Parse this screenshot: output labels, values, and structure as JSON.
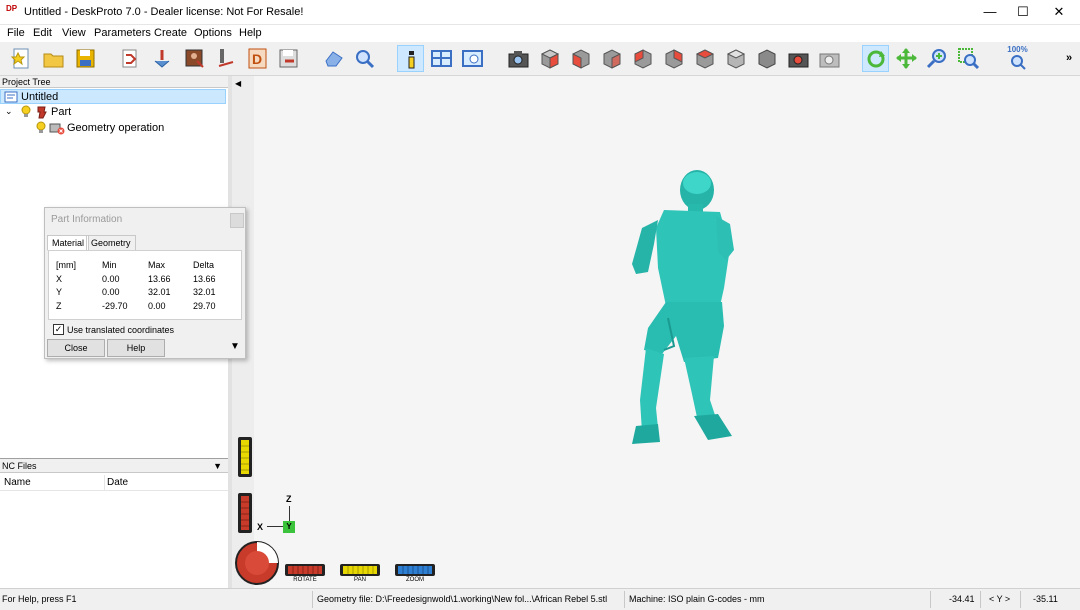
{
  "window": {
    "title": "Untitled - DeskProto 7.0 - Dealer license: Not For Resale!",
    "app_icon": "DP",
    "minimize": "—",
    "maximize": "☐",
    "close": "✕"
  },
  "menu": [
    "File",
    "Edit",
    "View",
    "Parameters",
    "Create",
    "Options",
    "Help"
  ],
  "toolbar": {
    "more": "»",
    "zoom_100": "100%"
  },
  "project_tree": {
    "header": "Project Tree",
    "root": "Untitled",
    "part": "Part",
    "geometry_operation": "Geometry operation"
  },
  "nc_files": {
    "header": "NC Files",
    "col_name": "Name",
    "col_date": "Date"
  },
  "part_info": {
    "title": "Part Information",
    "tabs": [
      "Material",
      "Geometry"
    ],
    "headers": [
      "[mm]",
      "Min",
      "Max",
      "Delta"
    ],
    "rows": [
      [
        "X",
        "0.00",
        "13.66",
        "13.66"
      ],
      [
        "Y",
        "0.00",
        "32.01",
        "32.01"
      ],
      [
        "Z",
        "-29.70",
        "0.00",
        "29.70"
      ]
    ],
    "checkbox_label": "Use translated coordinates",
    "checkbox_checked": true,
    "close_label": "Close",
    "help_label": "Help"
  },
  "viewport": {
    "axes": {
      "x": "X",
      "y": "Y",
      "z": "Z"
    },
    "controls": {
      "rotate": "ROTATE",
      "pan": "PAN",
      "zoom": "ZOOM"
    },
    "model_color": "#2fc4b8"
  },
  "status": {
    "help": "For Help, press F1",
    "geometry_file": "Geometry file: D:\\Freedesignwold\\1.working\\New fol...\\African Rebel 5.stl",
    "machine": "Machine: ISO plain G-codes - mm",
    "x_value": "-34.41",
    "axis_label": "< Y >",
    "y_value": "-35.11"
  },
  "colors": {
    "selection": "#cce8ff",
    "accent": "#0078d7",
    "model": "#2fc4b8",
    "rotate": "#c83a2a",
    "pan": "#e6d800",
    "zoom": "#2d7fd3"
  }
}
